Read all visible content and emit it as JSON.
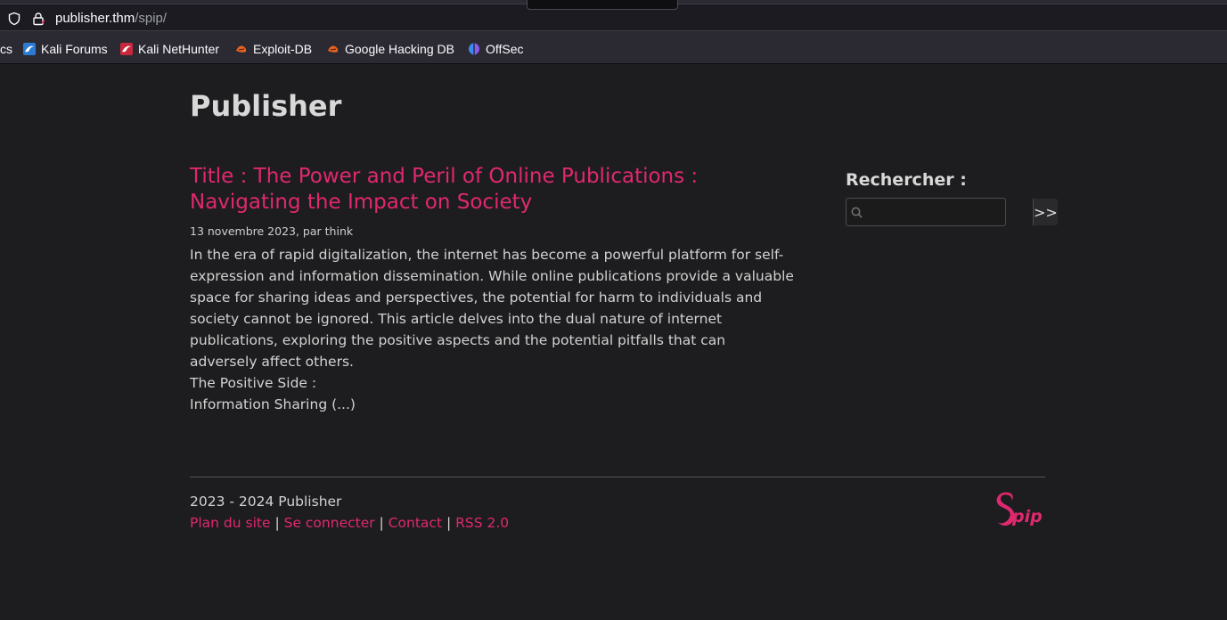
{
  "browser": {
    "url_host": "publisher.thm",
    "url_path": "/spip/",
    "bookmarks": [
      {
        "label": "cs",
        "icon": "kali-docs-icon"
      },
      {
        "label": "Kali Forums",
        "icon": "kali-forums-icon"
      },
      {
        "label": "Kali NetHunter",
        "icon": "kali-nethunter-icon"
      },
      {
        "label": "Exploit-DB",
        "icon": "exploit-db-icon"
      },
      {
        "label": "Google Hacking DB",
        "icon": "ghdb-icon"
      },
      {
        "label": "OffSec",
        "icon": "offsec-icon"
      }
    ]
  },
  "site": {
    "title": "Publisher"
  },
  "article": {
    "title": "Title : The Power and Peril of Online Publications : Navigating the Impact on Society",
    "meta": "13 novembre 2023, par think",
    "intro": "In the era of rapid digitalization, the internet has become a powerful platform for self-expression and information dissemination. While online publications provide a valuable space for sharing ideas and perspectives, the potential for harm to individuals and society cannot be ignored. This article delves into the dual nature of internet publications, exploring the positive aspects and the potential pitfalls that can adversely affect others.",
    "subheading": "The Positive Side :",
    "more": "Information Sharing (...)"
  },
  "search": {
    "label": "Rechercher :",
    "value": "",
    "button_label": ">>"
  },
  "footer": {
    "copyright": "2023 - 2024 Publisher",
    "links": {
      "sitemap": "Plan du site",
      "login": "Se connecter",
      "contact": "Contact",
      "rss": "RSS 2.0"
    },
    "separator": "|",
    "logo_text": "pip"
  },
  "colors": {
    "accent": "#e0286e",
    "background": "#1d1d1f",
    "text": "#d2d2d2"
  }
}
